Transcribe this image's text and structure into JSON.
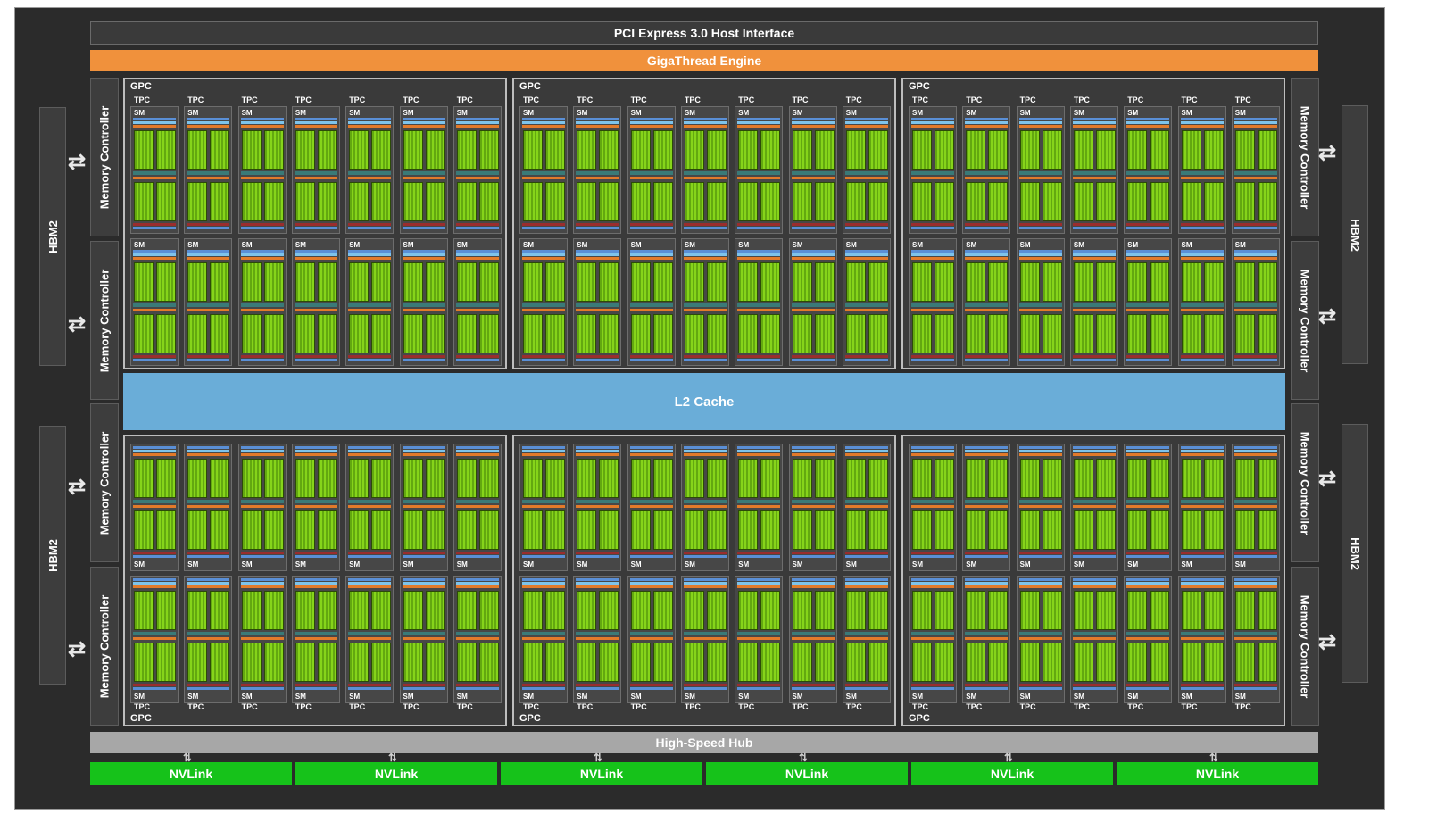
{
  "diagram": {
    "host_interface": "PCI Express 3.0 Host Interface",
    "gigathread": "GigaThread Engine",
    "l2_cache": "L2 Cache",
    "high_speed_hub": "High-Speed Hub",
    "nvlinks": [
      "NVLink",
      "NVLink",
      "NVLink",
      "NVLink",
      "NVLink",
      "NVLink"
    ],
    "hbm": [
      "HBM2",
      "HBM2",
      "HBM2",
      "HBM2"
    ],
    "memory_controllers": [
      "Memory Controller",
      "Memory Controller",
      "Memory Controller",
      "Memory Controller",
      "Memory Controller",
      "Memory Controller",
      "Memory Controller",
      "Memory Controller"
    ],
    "gpc_label": "GPC",
    "tpc_label": "TPC",
    "sm_label": "SM",
    "gpc_count": 6,
    "tpcs_per_gpc": 7,
    "sms_per_tpc": 2,
    "colors": {
      "chip_bg": "#2b2b2b",
      "gigathread": "#f0913c",
      "l2_cache": "#6aadd8",
      "hub": "#a7a7a7",
      "nvlink": "#16c21a",
      "core_green": "#86d41a"
    }
  }
}
